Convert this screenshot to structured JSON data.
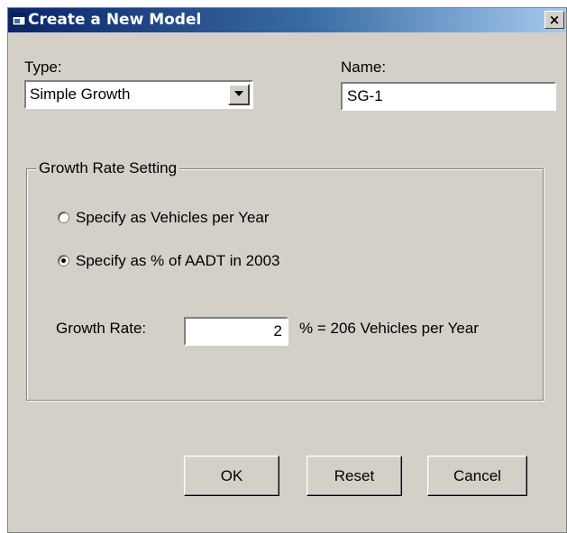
{
  "window": {
    "title": "Create a New Model",
    "close_label": "×"
  },
  "type_field": {
    "label": "Type:",
    "value": "Simple Growth"
  },
  "name_field": {
    "label": "Name:",
    "value": "SG-1"
  },
  "group": {
    "title": "Growth Rate Setting",
    "options": [
      {
        "label": "Specify as Vehicles per Year",
        "selected": false
      },
      {
        "label": "Specify as % of AADT in 2003",
        "selected": true
      }
    ],
    "rate_label": "Growth Rate:",
    "rate_value": "2",
    "rate_result": "% = 206 Vehicles per Year"
  },
  "buttons": {
    "ok": "OK",
    "reset": "Reset",
    "cancel": "Cancel"
  }
}
